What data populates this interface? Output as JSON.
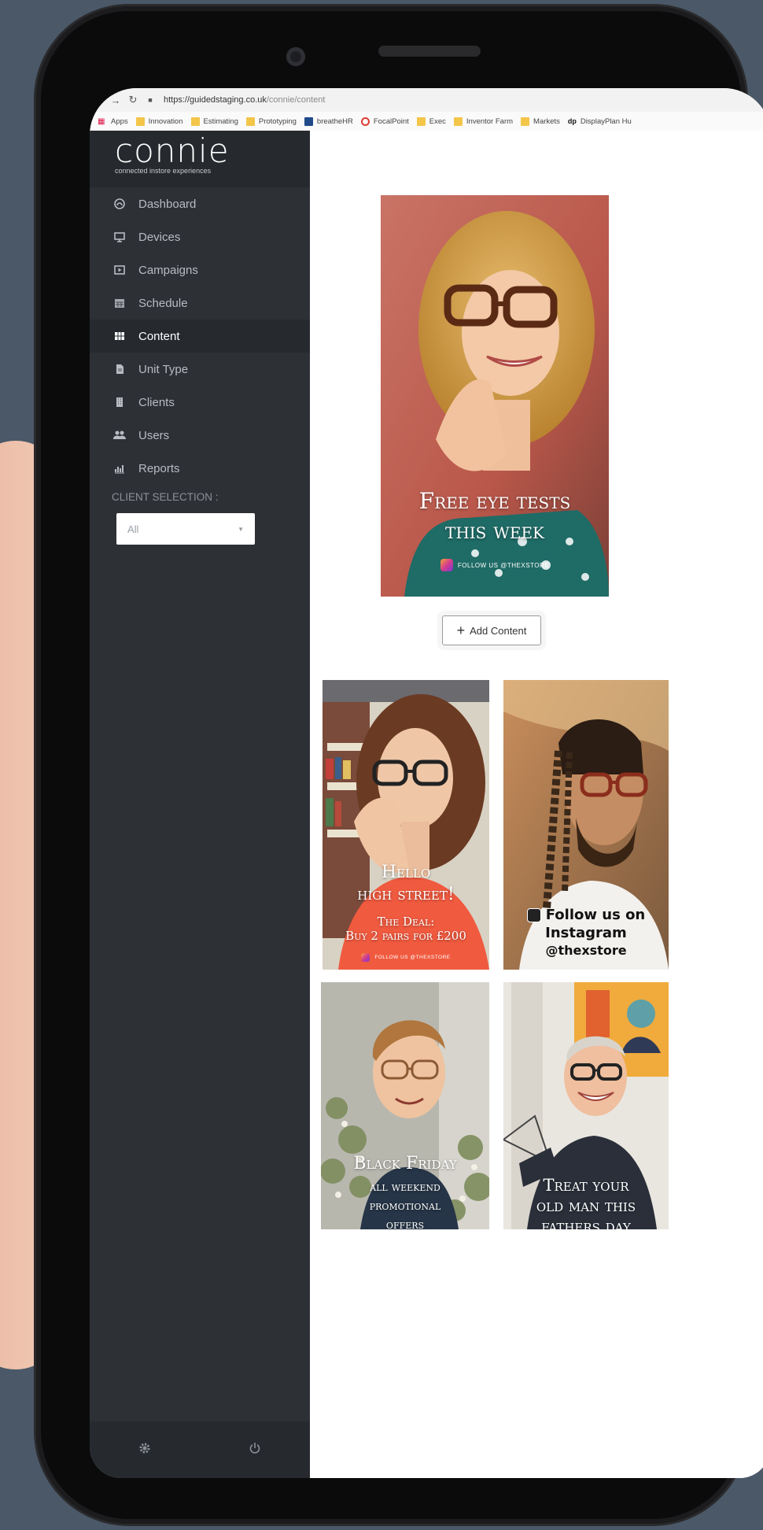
{
  "browser": {
    "url_host": "https://guidedstaging.co.uk",
    "url_path": "/connie/content",
    "bookmarks": [
      "Apps",
      "Innovation",
      "Estimating",
      "Prototyping",
      "breatheHR",
      "FocalPoint",
      "Exec",
      "Inventor Farm",
      "Markets",
      "DisplayPlan Hu"
    ]
  },
  "brand": {
    "name": "connie",
    "tagline": "connected instore experiences"
  },
  "sidebar": {
    "items": [
      {
        "label": "Dashboard",
        "icon": "dashboard-icon"
      },
      {
        "label": "Devices",
        "icon": "monitor-icon"
      },
      {
        "label": "Campaigns",
        "icon": "play-square-icon"
      },
      {
        "label": "Schedule",
        "icon": "calendar-icon"
      },
      {
        "label": "Content",
        "icon": "grid-icon",
        "active": true
      },
      {
        "label": "Unit Type",
        "icon": "file-icon"
      },
      {
        "label": "Clients",
        "icon": "building-icon"
      },
      {
        "label": "Users",
        "icon": "users-icon"
      },
      {
        "label": "Reports",
        "icon": "bar-chart-icon"
      }
    ],
    "client_label": "CLIENT SELECTION :",
    "client_value": "All"
  },
  "main": {
    "add_content_label": "Add Content",
    "hero": {
      "line1": "Free eye tests",
      "line2": "this week",
      "follow": "FOLLOW US @THEXSTORE"
    },
    "cards": [
      {
        "line1": "Hello",
        "line2": "high street!",
        "line3": "The Deal:",
        "line4": "Buy 2 pairs for £200",
        "follow": "FOLLOW US @THEXSTORE"
      },
      {
        "line1": "Follow us on",
        "line2": "Instagram",
        "line3": "@thexstore"
      },
      {
        "line1": "Black Friday",
        "line2": "all weekend",
        "line3": "promotional",
        "line4": "offers"
      },
      {
        "line1": "Treat your",
        "line2": "old man this",
        "line3": "fathers day"
      }
    ]
  },
  "colors": {
    "sidebar": "#2d3035",
    "page_bg": "#4a5868",
    "active_bg": "#262a2f"
  }
}
